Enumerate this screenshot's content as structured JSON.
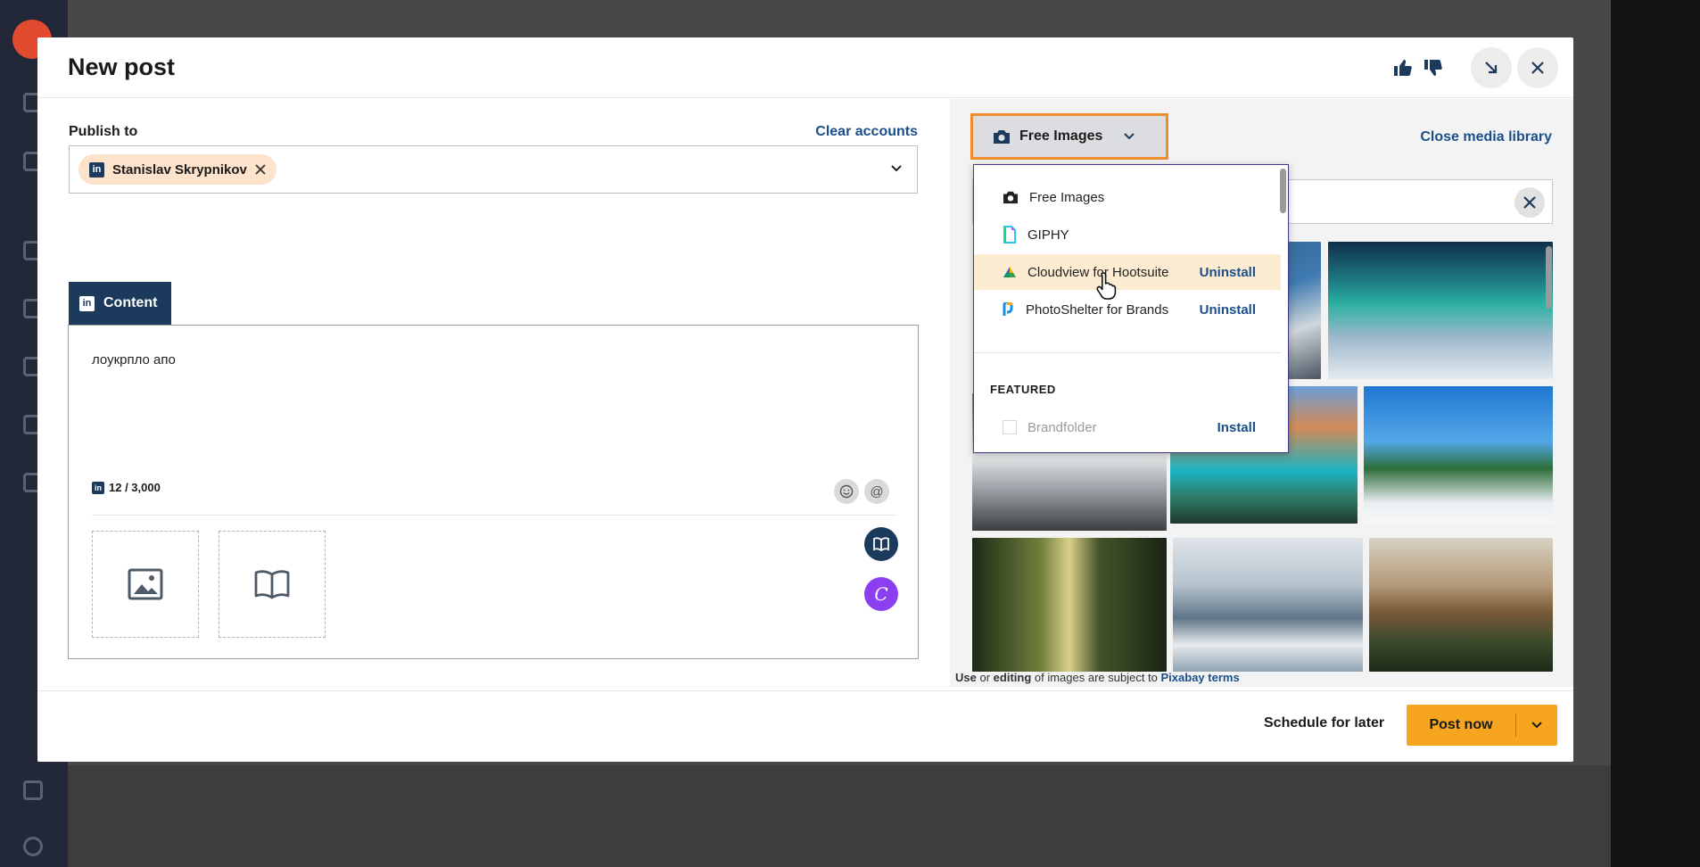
{
  "modal": {
    "title": "New post"
  },
  "publish": {
    "label": "Publish to",
    "clear_label": "Clear accounts",
    "account": {
      "name": "Stanislav Skrypnikov",
      "network": "linkedin"
    }
  },
  "composer": {
    "tab_label": "Content",
    "text": "лоукрпло апо",
    "char_count": "12 / 3,000",
    "network_badge": "in"
  },
  "media": {
    "source_label": "Free Images",
    "close_label": "Close media library",
    "dropdown": {
      "items": [
        {
          "label": "Free Images",
          "action": "",
          "icon": "camera-icon"
        },
        {
          "label": "GIPHY",
          "action": "",
          "icon": "giphy-icon"
        },
        {
          "label": "Cloudview for Hootsuite",
          "action": "Uninstall",
          "icon": "cloudview-icon",
          "highlighted": true
        },
        {
          "label": "PhotoShelter for Brands",
          "action": "Uninstall",
          "icon": "photoshelter-icon"
        }
      ],
      "featured_heading": "FEATURED",
      "featured_items": [
        {
          "label": "Brandfolder",
          "action": "Install"
        }
      ]
    },
    "terms": {
      "prefix": "Use",
      "middle1": " or ",
      "editing": "editing",
      "middle2": " of images are subject to ",
      "link": "Pixabay terms"
    }
  },
  "footer": {
    "schedule_label": "Schedule for later",
    "post_label": "Post now"
  },
  "colors": {
    "accent": "#f7a51e",
    "brand_navy": "#1b3a5c",
    "link": "#1b4f8a",
    "highlight": "#fdebd2"
  }
}
